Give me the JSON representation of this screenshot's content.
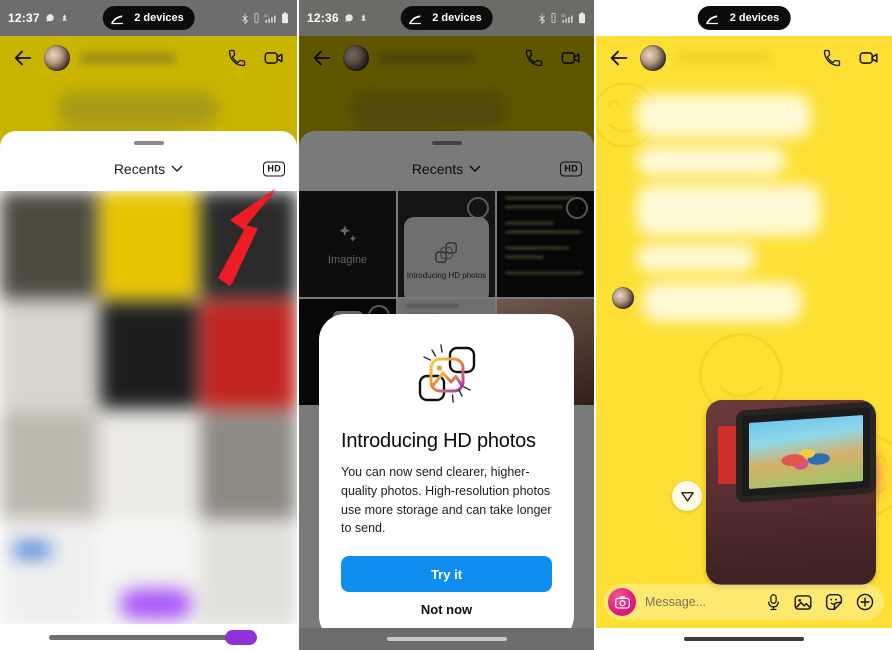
{
  "panels": [
    {
      "id": "panel-gallery-hd-toggle",
      "statusbar": {
        "time": "12:37",
        "pill_label": "2 devices",
        "icons": [
          "chat-icon",
          "notification-icon",
          "bluetooth-icon",
          "vibrate-icon",
          "signal-icon",
          "battery-icon"
        ]
      },
      "chat_header": {
        "back": "←",
        "contact_name": "",
        "call_icon": "phone-icon",
        "video_icon": "video-icon"
      },
      "sheet": {
        "title": "Recents",
        "chevron": "⌄",
        "hd_badge": "HD"
      },
      "annotation": {
        "type": "arrow",
        "color": "#ee1c24",
        "points_to": "hd-badge"
      }
    },
    {
      "id": "panel-hd-photos-dialog",
      "statusbar": {
        "time": "12:36",
        "pill_label": "2 devices",
        "icons": [
          "chat-icon",
          "notification-icon",
          "bluetooth-icon",
          "vibrate-icon",
          "signal-icon",
          "battery-icon"
        ]
      },
      "chat_header": {
        "back": "←",
        "contact_name": "",
        "call_icon": "phone-icon",
        "video_icon": "video-icon"
      },
      "sheet": {
        "title": "Recents",
        "chevron": "⌄",
        "hd_badge": "HD"
      },
      "gallery_tiles": [
        {
          "label": "Imagine",
          "kind": "imagine"
        },
        {
          "label": "Introducing HD photos",
          "kind": "screenshot-card"
        },
        {
          "label": "",
          "kind": "screenshot-text"
        },
        {
          "label": "",
          "kind": "screenshot-phone"
        },
        {
          "label": "",
          "kind": "screenshot-doc"
        },
        {
          "label": "",
          "kind": "photo"
        }
      ],
      "dialog": {
        "icon": "hd-photo-icon",
        "title": "Introducing HD photos",
        "body": "You can now send clearer, higher-quality photos. High-resolution photos use more storage and can take longer to send.",
        "primary_button": "Try it",
        "secondary_button": "Not now",
        "primary_color": "#0f8ef0"
      }
    },
    {
      "id": "panel-chat-hd-sent",
      "statusbar": {
        "time": "",
        "pill_label": "2 devices",
        "icons": [
          "cast-icon"
        ]
      },
      "chat_header": {
        "back": "←",
        "contact_name": "",
        "call_icon": "phone-icon",
        "video_icon": "video-icon"
      },
      "composer": {
        "camera_icon": "camera-icon",
        "placeholder": "Message...",
        "icons": [
          "mic-icon",
          "gallery-icon",
          "sticker-icon",
          "plus-icon"
        ]
      },
      "send_button": "send-icon",
      "sent_photo": "photo-attachment"
    }
  ],
  "theme": {
    "accent_blue": "#0f8ef0",
    "chat_yellow_bright": "#fde033",
    "chat_yellow_dull": "#c9b400",
    "arrow_red": "#ee1c24",
    "camera_pink": "#e0177f"
  }
}
